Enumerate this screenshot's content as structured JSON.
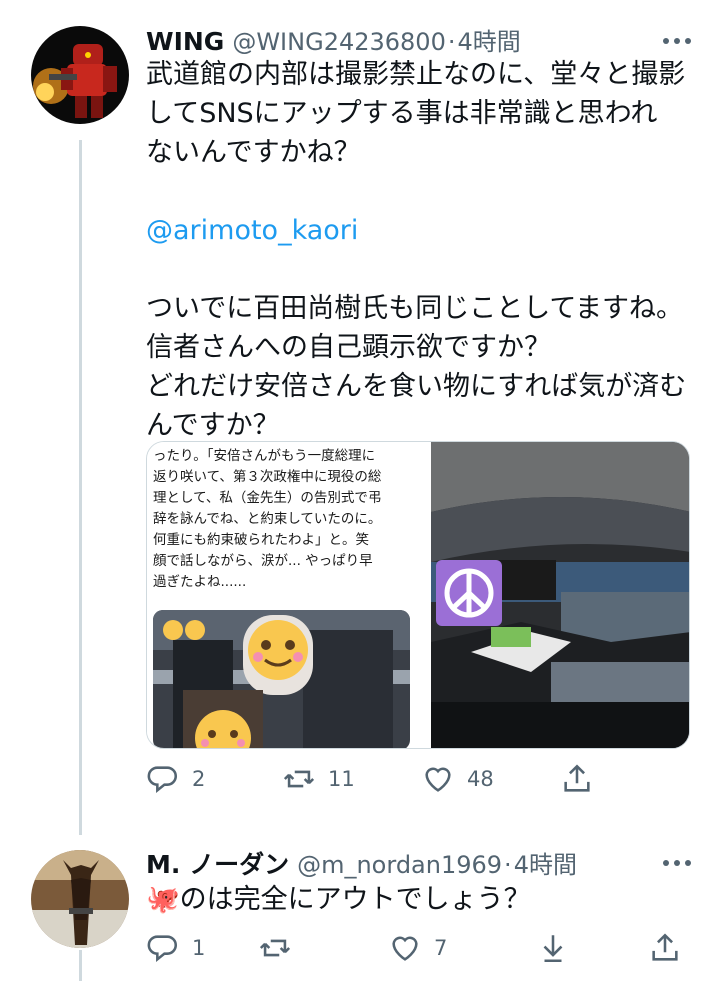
{
  "tweets": [
    {
      "name": "WING",
      "handle": "@WING24236800",
      "separator": "·",
      "time": "4時間",
      "text_line1": "武道館の内部は撮影禁止なのに、堂々と撮影",
      "text_line2": "してSNSにアップする事は非常識と思われ",
      "text_line3": "ないんですかね？",
      "mention": "@arimoto_kaori",
      "text_line4": "ついでに百田尚樹氏も同じことしてますね。",
      "text_line5": "信者さんへの自己顕示欲ですか？",
      "text_line6": "どれだけ安倍さんを食い物にすれば気が済む",
      "text_line7": "んですか？",
      "media_caption": "ったり。「安倍さんがもう一度総理に\n返り咲いて、第３次政権中に現役の総\n理として、私（金先生）の告別式で弔\n辞を詠んでね、と約束していたのに。\n何重にも約束破られたわよ」と。笑\n顔で話しながら、涙が... やっぱり早\n過ぎたよね......",
      "reply_count": "2",
      "retweet_count": "11",
      "like_count": "48"
    },
    {
      "name": "M.  ノーダン",
      "handle": "@m_nordan1969",
      "separator": "·",
      "time": "4時間",
      "text_line1": "🐙のは完全にアウトでしょう？",
      "reply_count": "1",
      "retweet_count": "",
      "like_count": "7"
    }
  ],
  "icons": {
    "reply": "reply-icon",
    "retweet": "retweet-icon",
    "like": "heart-icon",
    "share": "share-icon",
    "download": "download-icon",
    "more": "more-icon"
  },
  "colors": {
    "text": "#0f1419",
    "secondary": "#536471",
    "link": "#1d9bf0",
    "thread_line": "#cfd9de",
    "peace_symbol_bg": "#9b6fd6"
  }
}
